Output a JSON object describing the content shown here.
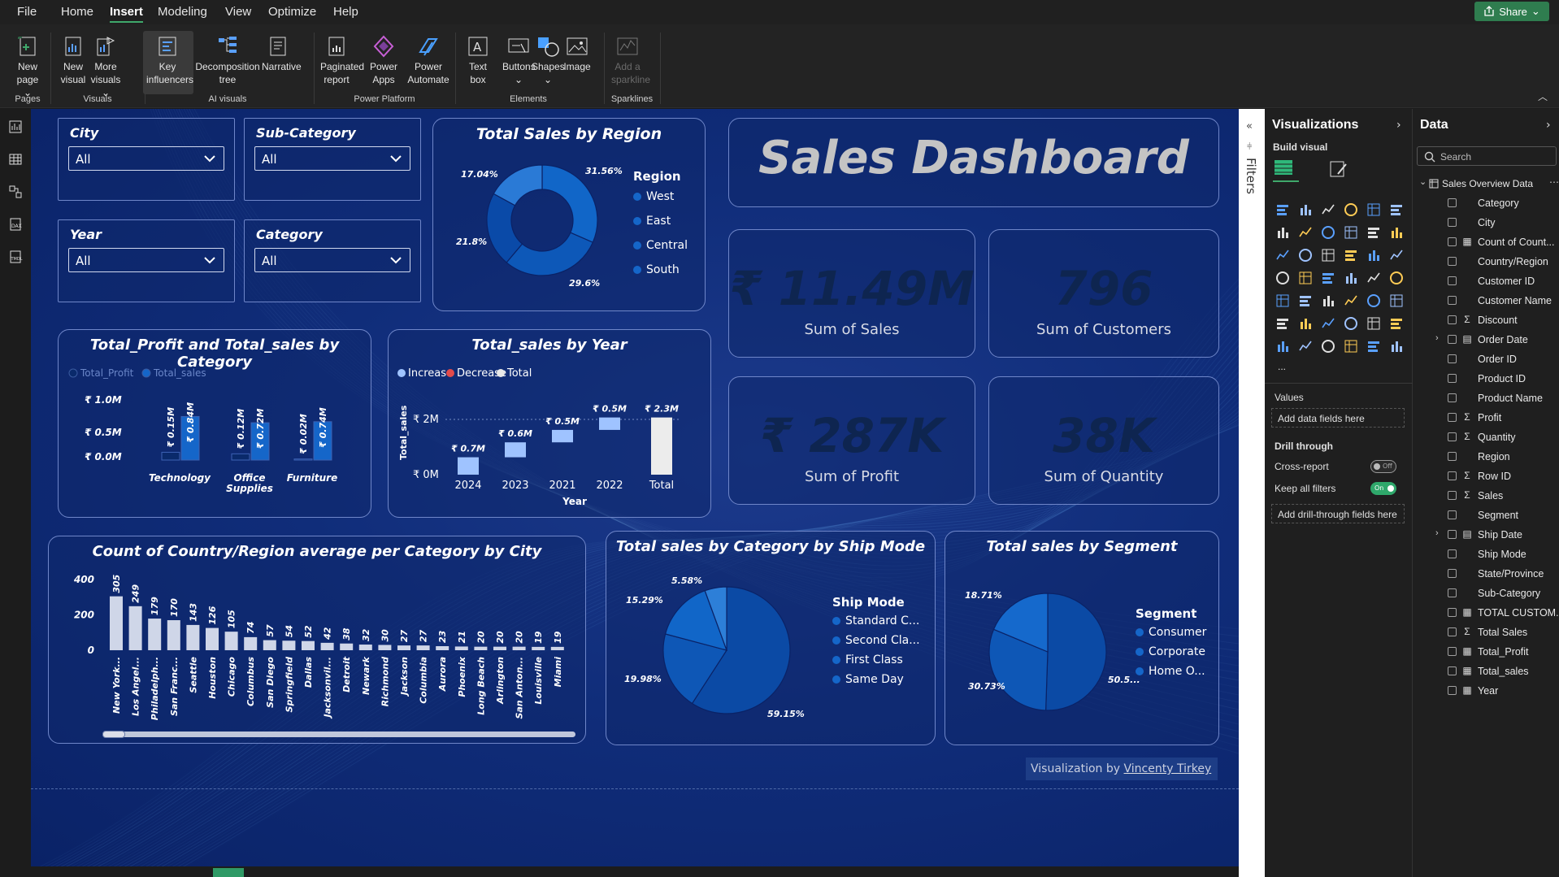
{
  "menu": {
    "items": [
      "File",
      "Home",
      "Insert",
      "Modeling",
      "View",
      "Optimize",
      "Help"
    ],
    "active": "Insert",
    "share": "Share"
  },
  "ribbon": {
    "buttons": [
      {
        "label1": "New",
        "label2": "page",
        "chev": true,
        "icon": "new-page-icon"
      },
      {
        "label1": "New",
        "label2": "visual",
        "icon": "new-visual-icon"
      },
      {
        "label1": "More",
        "label2": "visuals",
        "chev": true,
        "icon": "more-visuals-icon"
      },
      {
        "label1": "Key",
        "label2": "influencers",
        "icon": "key-influencers-icon"
      },
      {
        "label1": "Decomposition",
        "label2": "tree",
        "icon": "decomposition-tree-icon"
      },
      {
        "label1": "Narrative",
        "label2": "",
        "icon": "narrative-icon"
      },
      {
        "label1": "Paginated",
        "label2": "report",
        "icon": "paginated-report-icon"
      },
      {
        "label1": "Power",
        "label2": "Apps",
        "icon": "power-apps-icon"
      },
      {
        "label1": "Power",
        "label2": "Automate",
        "icon": "power-automate-icon"
      },
      {
        "label1": "Text",
        "label2": "box",
        "icon": "text-box-icon"
      },
      {
        "label1": "Buttons",
        "label2": "",
        "chev": true,
        "icon": "buttons-icon"
      },
      {
        "label1": "Shapes",
        "label2": "",
        "chev": true,
        "icon": "shapes-icon"
      },
      {
        "label1": "Image",
        "label2": "",
        "icon": "image-icon"
      },
      {
        "label1": "Add a",
        "label2": "sparkline",
        "icon": "sparkline-icon",
        "disabled": true
      }
    ],
    "groups": [
      "Pages",
      "Visuals",
      "AI visuals",
      "Power Platform",
      "Elements",
      "Sparklines"
    ]
  },
  "slicers": [
    {
      "title": "City",
      "value": "All"
    },
    {
      "title": "Sub-Category",
      "value": "All"
    },
    {
      "title": "Year",
      "value": "All"
    },
    {
      "title": "Category",
      "value": "All"
    }
  ],
  "dashboard_title": "Sales Dashboard",
  "kpis": [
    {
      "value": "₹ 11.49M",
      "label": "Sum of  Sales"
    },
    {
      "value": "796",
      "label": "Sum of Customers"
    },
    {
      "value": "₹ 287K",
      "label": "Sum of Profit"
    },
    {
      "value": "38K",
      "label": "Sum of Quantity"
    }
  ],
  "credit": {
    "prefix": "Visualization by ",
    "name": "Vincenty Tirkey"
  },
  "chart_data": [
    {
      "type": "pie",
      "title": "Total Sales by Region",
      "legend_title": "Region",
      "categories": [
        "West",
        "East",
        "Central",
        "South"
      ],
      "values": [
        31.56,
        29.6,
        21.8,
        17.04
      ],
      "value_labels": [
        "31.56%",
        "29.6%",
        "21.8%",
        "17.04%"
      ],
      "colors": [
        "#1166c8",
        "#0d58b8",
        "#0a4aa8",
        "#2a7ad6"
      ],
      "donut": true
    },
    {
      "type": "bar",
      "title": "Total_Profit and Total_sales by Category",
      "categories": [
        "Technology",
        "Office Supplies",
        "Furniture"
      ],
      "series": [
        {
          "name": "Total_Profit",
          "values": [
            0.15,
            0.12,
            0.02
          ],
          "labels": [
            "₹ 0.15M",
            "₹ 0.12M",
            "₹ 0.02M"
          ]
        },
        {
          "name": "Total_sales",
          "values": [
            0.84,
            0.72,
            0.74
          ],
          "labels": [
            "₹ 0.84M",
            "₹ 0.72M",
            "₹ 0.74M"
          ]
        }
      ],
      "yticks": [
        "₹ 1.0M",
        "₹ 0.5M",
        "₹ 0.0M"
      ],
      "ylim": [
        0,
        1.0
      ]
    },
    {
      "type": "bar",
      "subtype": "waterfall",
      "title": "Total_sales by Year",
      "legend": [
        "Increase",
        "Decrease",
        "Total"
      ],
      "categories": [
        "2024",
        "2023",
        "2021",
        "2022",
        "Total"
      ],
      "values": [
        0.7,
        0.6,
        0.5,
        0.5,
        2.3
      ],
      "labels": [
        "₹ 0.7M",
        "₹ 0.6M",
        "₹ 0.5M",
        "₹ 0.5M",
        "₹ 2.3M"
      ],
      "yticks": [
        "₹ 2M",
        "₹ 0M"
      ],
      "ylabel": "Total_sales",
      "xlabel": "Year",
      "ylim": [
        0,
        2.5
      ]
    },
    {
      "type": "bar",
      "title": "Count of Country/Region average per Category by City",
      "categories": [
        "New York...",
        "Los Angel...",
        "Philadelph...",
        "San Franc...",
        "Seattle",
        "Houston",
        "Chicago",
        "Columbus",
        "San Diego",
        "Springfield",
        "Dallas",
        "Jacksonvil...",
        "Detroit",
        "Newark",
        "Richmond",
        "Jackson",
        "Columbia",
        "Aurora",
        "Phoenix",
        "Long Beach",
        "Arlington",
        "San Anton...",
        "Louisville",
        "Miami"
      ],
      "values": [
        305,
        249,
        179,
        170,
        143,
        126,
        105,
        74,
        57,
        54,
        52,
        42,
        38,
        32,
        30,
        27,
        27,
        23,
        21,
        20,
        20,
        20,
        19,
        19
      ],
      "yticks": [
        "400",
        "200",
        "0"
      ],
      "ylim": [
        0,
        400
      ]
    },
    {
      "type": "pie",
      "title": "Total sales by Category by Ship Mode",
      "legend_title": "Ship Mode",
      "categories": [
        "Standard C...",
        "Second Cla...",
        "First Class",
        "Same Day"
      ],
      "values": [
        59.15,
        19.98,
        15.29,
        5.58
      ],
      "value_labels": [
        "59.15%",
        "19.98%",
        "15.29%",
        "5.58%"
      ],
      "colors": [
        "#0b4aa5",
        "#0e57b6",
        "#1166c8",
        "#2d7fd8"
      ]
    },
    {
      "type": "pie",
      "title": "Total sales by Segment",
      "legend_title": "Segment",
      "categories": [
        "Consumer",
        "Corporate",
        "Home O..."
      ],
      "values": [
        50.5,
        30.73,
        18.71
      ],
      "value_labels": [
        "50.5...",
        "30.73%",
        "18.71%"
      ],
      "colors": [
        "#0b4aa5",
        "#0e57b6",
        "#1569cc"
      ]
    }
  ],
  "filters_label": "Filters",
  "viz_pane": {
    "title": "Visualizations",
    "build": "Build visual",
    "values_label": "Values",
    "add_fields": "Add data fields here",
    "drill_through": "Drill through",
    "cross_report": "Cross-report",
    "cross_report_state": "Off",
    "keep_filters": "Keep all filters",
    "keep_filters_state": "On",
    "add_drill": "Add drill-through fields here",
    "more": "..."
  },
  "data_pane": {
    "title": "Data",
    "search_placeholder": "Search",
    "table": "Sales Overview Data",
    "fields": [
      {
        "name": "Category",
        "sym": ""
      },
      {
        "name": "City",
        "sym": ""
      },
      {
        "name": "Count of Count...",
        "sym": "calc"
      },
      {
        "name": "Country/Region",
        "sym": ""
      },
      {
        "name": "Customer ID",
        "sym": ""
      },
      {
        "name": "Customer Name",
        "sym": ""
      },
      {
        "name": "Discount",
        "sym": "sigma"
      },
      {
        "name": "Order Date",
        "sym": "table",
        "expand": true
      },
      {
        "name": "Order ID",
        "sym": ""
      },
      {
        "name": "Product ID",
        "sym": ""
      },
      {
        "name": "Product Name",
        "sym": ""
      },
      {
        "name": "Profit",
        "sym": "sigma"
      },
      {
        "name": "Quantity",
        "sym": "sigma"
      },
      {
        "name": "Region",
        "sym": ""
      },
      {
        "name": "Row ID",
        "sym": "sigma"
      },
      {
        "name": "Sales",
        "sym": "sigma"
      },
      {
        "name": "Segment",
        "sym": ""
      },
      {
        "name": "Ship Date",
        "sym": "table",
        "expand": true
      },
      {
        "name": "Ship Mode",
        "sym": ""
      },
      {
        "name": "State/Province",
        "sym": ""
      },
      {
        "name": "Sub-Category",
        "sym": ""
      },
      {
        "name": "TOTAL CUSTOM...",
        "sym": "calc"
      },
      {
        "name": "Total Sales",
        "sym": "sigma"
      },
      {
        "name": "Total_Profit",
        "sym": "calc"
      },
      {
        "name": "Total_sales",
        "sym": "calc"
      },
      {
        "name": "Year",
        "sym": "calc"
      }
    ]
  }
}
